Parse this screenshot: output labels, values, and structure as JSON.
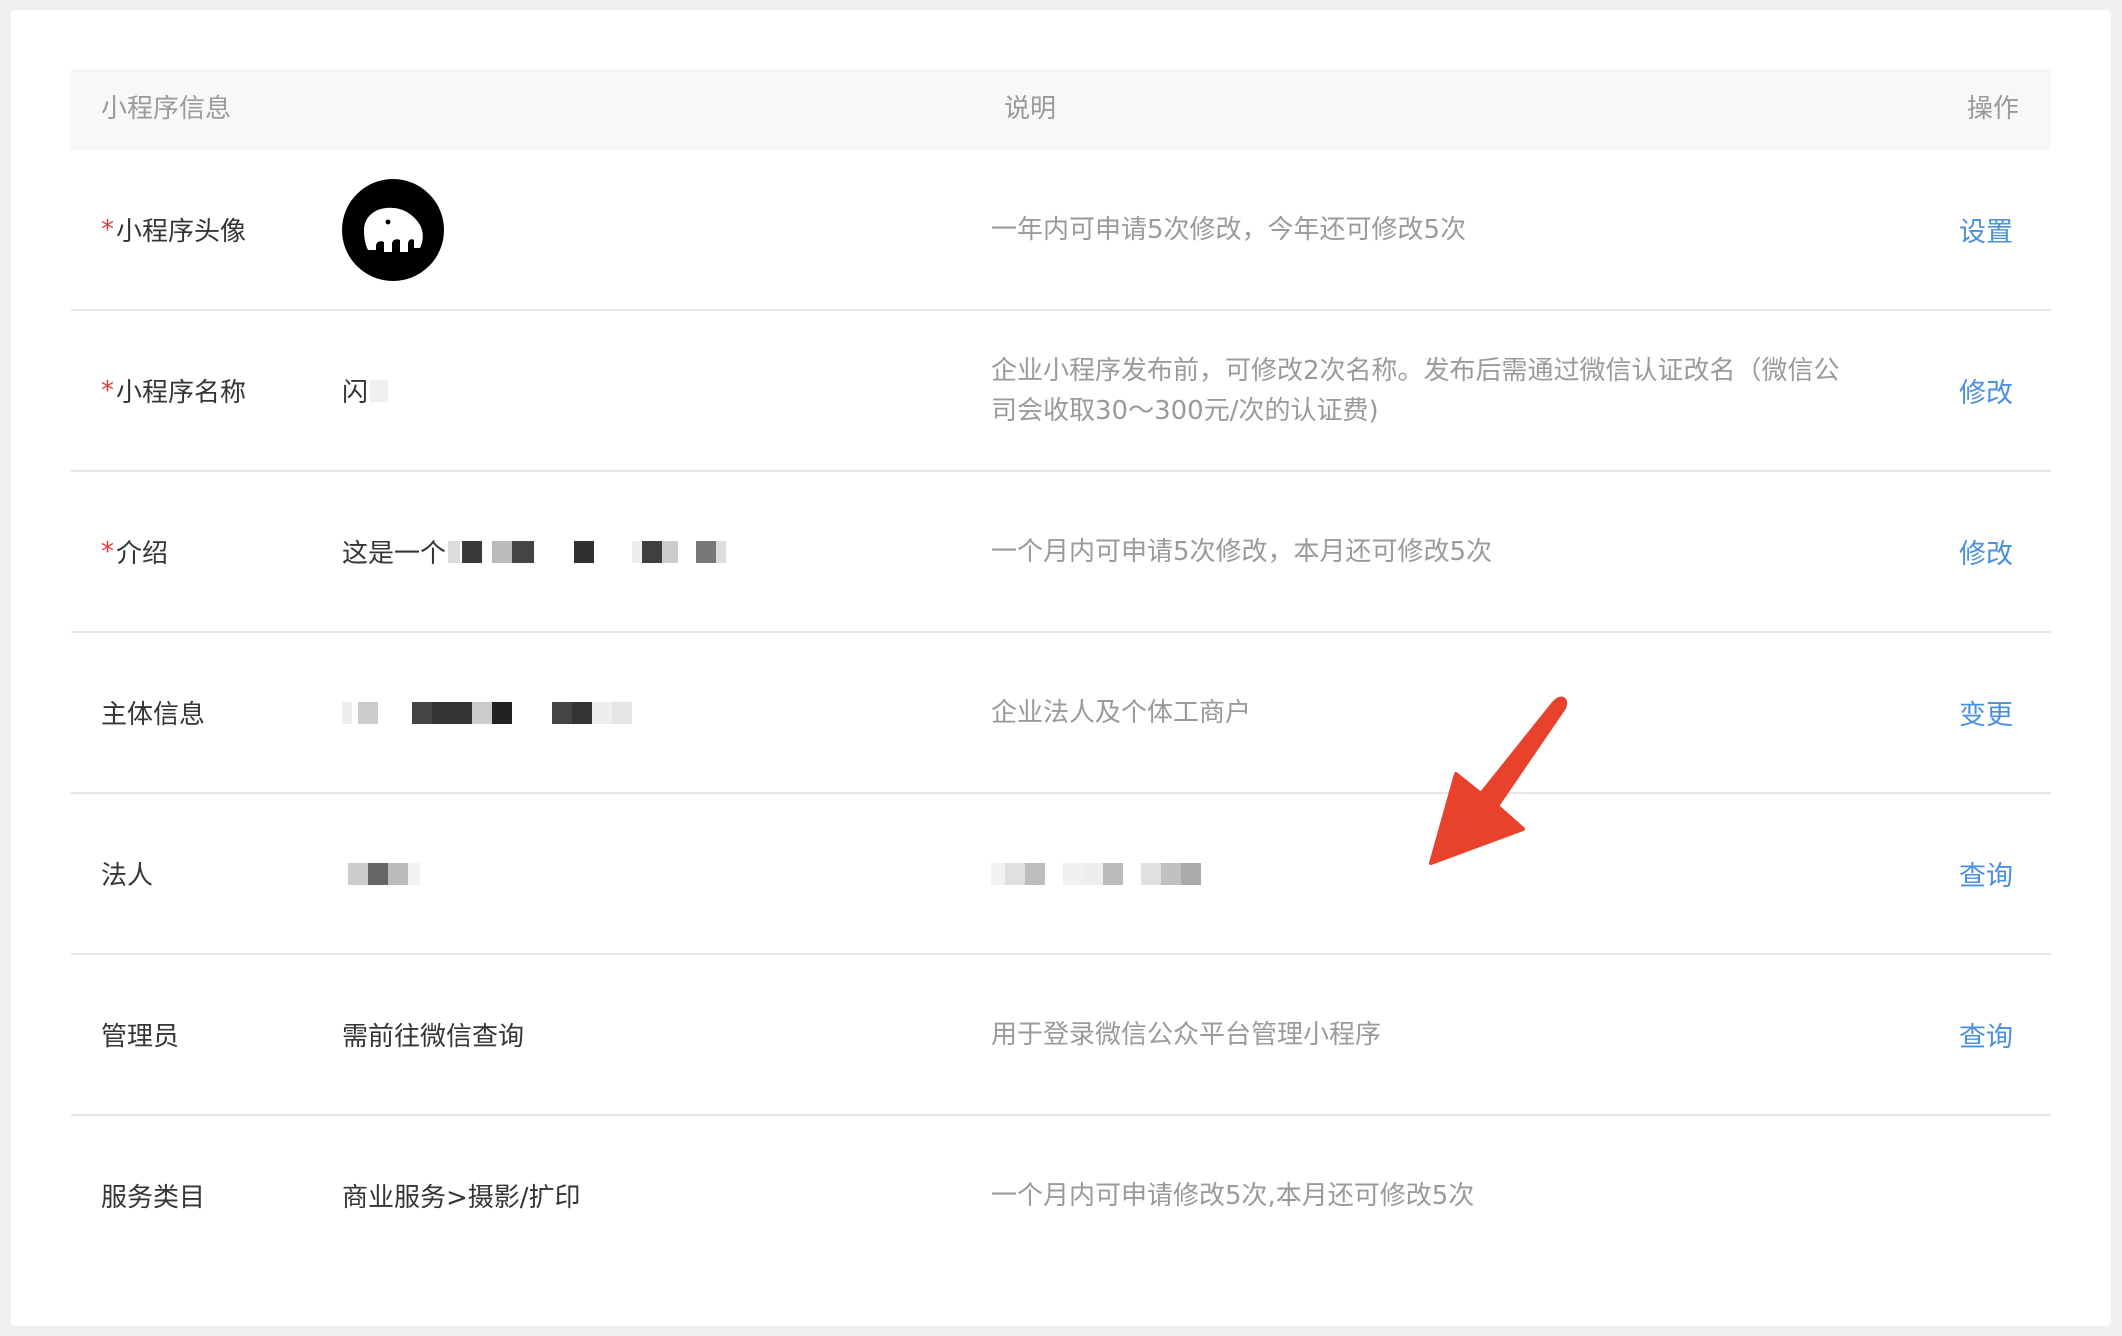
{
  "table": {
    "headers": {
      "info": "小程序信息",
      "desc": "说明",
      "op": "操作"
    },
    "rows": [
      {
        "required": true,
        "name": "小程序头像",
        "value": "",
        "desc": "一年内可申请5次修改，今年还可修改5次",
        "action": "设置"
      },
      {
        "required": true,
        "name": "小程序名称",
        "value": "闪",
        "desc": "企业小程序发布前，可修改2次名称。发布后需通过微信认证改名（微信公司会收取30～300元/次的认证费)",
        "action": "修改"
      },
      {
        "required": true,
        "name": "介绍",
        "value": "这是一个",
        "desc": "一个月内可申请5次修改，本月还可修改5次",
        "action": "修改"
      },
      {
        "required": false,
        "name": "主体信息",
        "value": "",
        "desc": "企业法人及个体工商户",
        "action": "变更"
      },
      {
        "required": false,
        "name": "法人",
        "value": "",
        "desc": "",
        "action": "查询"
      },
      {
        "required": false,
        "name": "管理员",
        "value": "需前往微信查询",
        "desc": "用于登录微信公众平台管理小程序",
        "action": "查询"
      },
      {
        "required": false,
        "name": "服务类目",
        "value": "商业服务>摄影/扩印",
        "desc": "一个月内可申请修改5次,本月还可修改5次",
        "action": ""
      }
    ]
  },
  "colors": {
    "accent": "#4a90e2",
    "required": "#e0393e",
    "arrow": "#e8412c"
  }
}
